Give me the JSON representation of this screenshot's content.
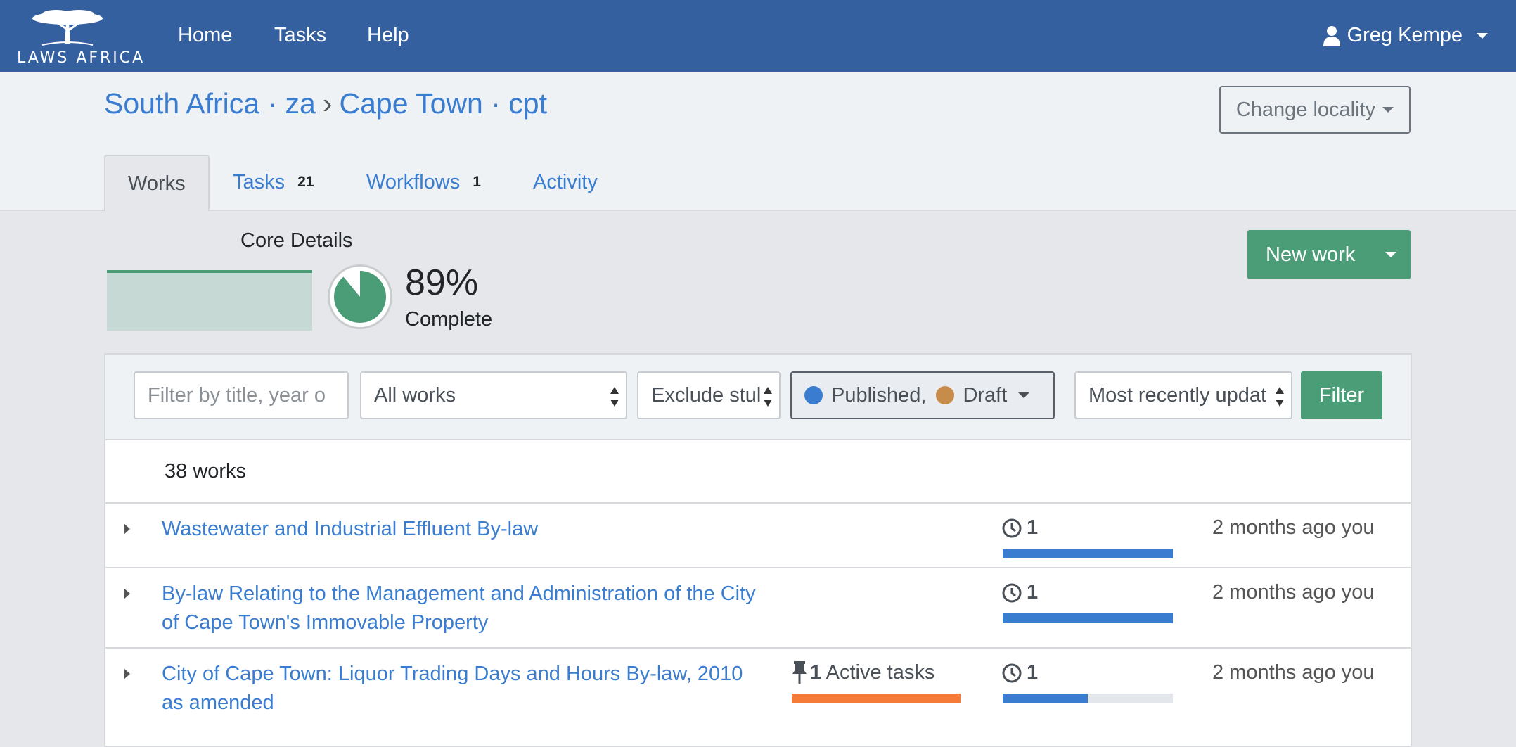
{
  "navbar": {
    "logo_text": "LAWS AFRICA",
    "links": [
      "Home",
      "Tasks",
      "Help"
    ],
    "user_name": "Greg Kempe"
  },
  "breadcrumb": {
    "country": "South Africa · za",
    "separator": "›",
    "locality": "Cape Town · cpt"
  },
  "change_locality_label": "Change locality",
  "tabs": [
    {
      "label": "Works",
      "count": ""
    },
    {
      "label": "Tasks",
      "count": "21"
    },
    {
      "label": "Workflows",
      "count": "1"
    },
    {
      "label": "Activity",
      "count": ""
    }
  ],
  "core_details": {
    "title": "Core Details",
    "percent_text": "89%",
    "percent_value": 89,
    "status_label": "Complete"
  },
  "new_work_label": "New work",
  "filters": {
    "search_placeholder": "Filter by title, year o",
    "works_select": "All works",
    "stubs_select": "Exclude stul",
    "status_published": "Published,",
    "status_draft": "Draft",
    "sort_select": "Most recently updat",
    "filter_button": "Filter"
  },
  "works_count": "38 works",
  "works": [
    {
      "title": "Wastewater and Industrial Effluent By-law",
      "versions": "1",
      "progress": 1.0,
      "updated": "2 months ago you",
      "tasks_count": "",
      "tasks_label": ""
    },
    {
      "title": "By-law Relating to the Management and Administration of the City of Cape Town's Immovable Property",
      "versions": "1",
      "progress": 1.0,
      "updated": "2 months ago you",
      "tasks_count": "",
      "tasks_label": ""
    },
    {
      "title": "City of Cape Town: Liquor Trading Days and Hours By-law, 2010 as amended",
      "versions": "1",
      "progress": 0.5,
      "updated": "2 months ago you",
      "tasks_count": "1",
      "tasks_label": "Active tasks"
    }
  ],
  "colors": {
    "navbar": "#3560a0",
    "link": "#3a7dd0",
    "success": "#4b9d78",
    "published_dot": "#3a7dd0",
    "draft_dot": "#c78c4a",
    "task_bar": "#f47b38"
  },
  "icons": {
    "user": "user-icon",
    "clock": "clock-icon",
    "pin": "pin-icon",
    "expand": "caret-right-icon"
  }
}
